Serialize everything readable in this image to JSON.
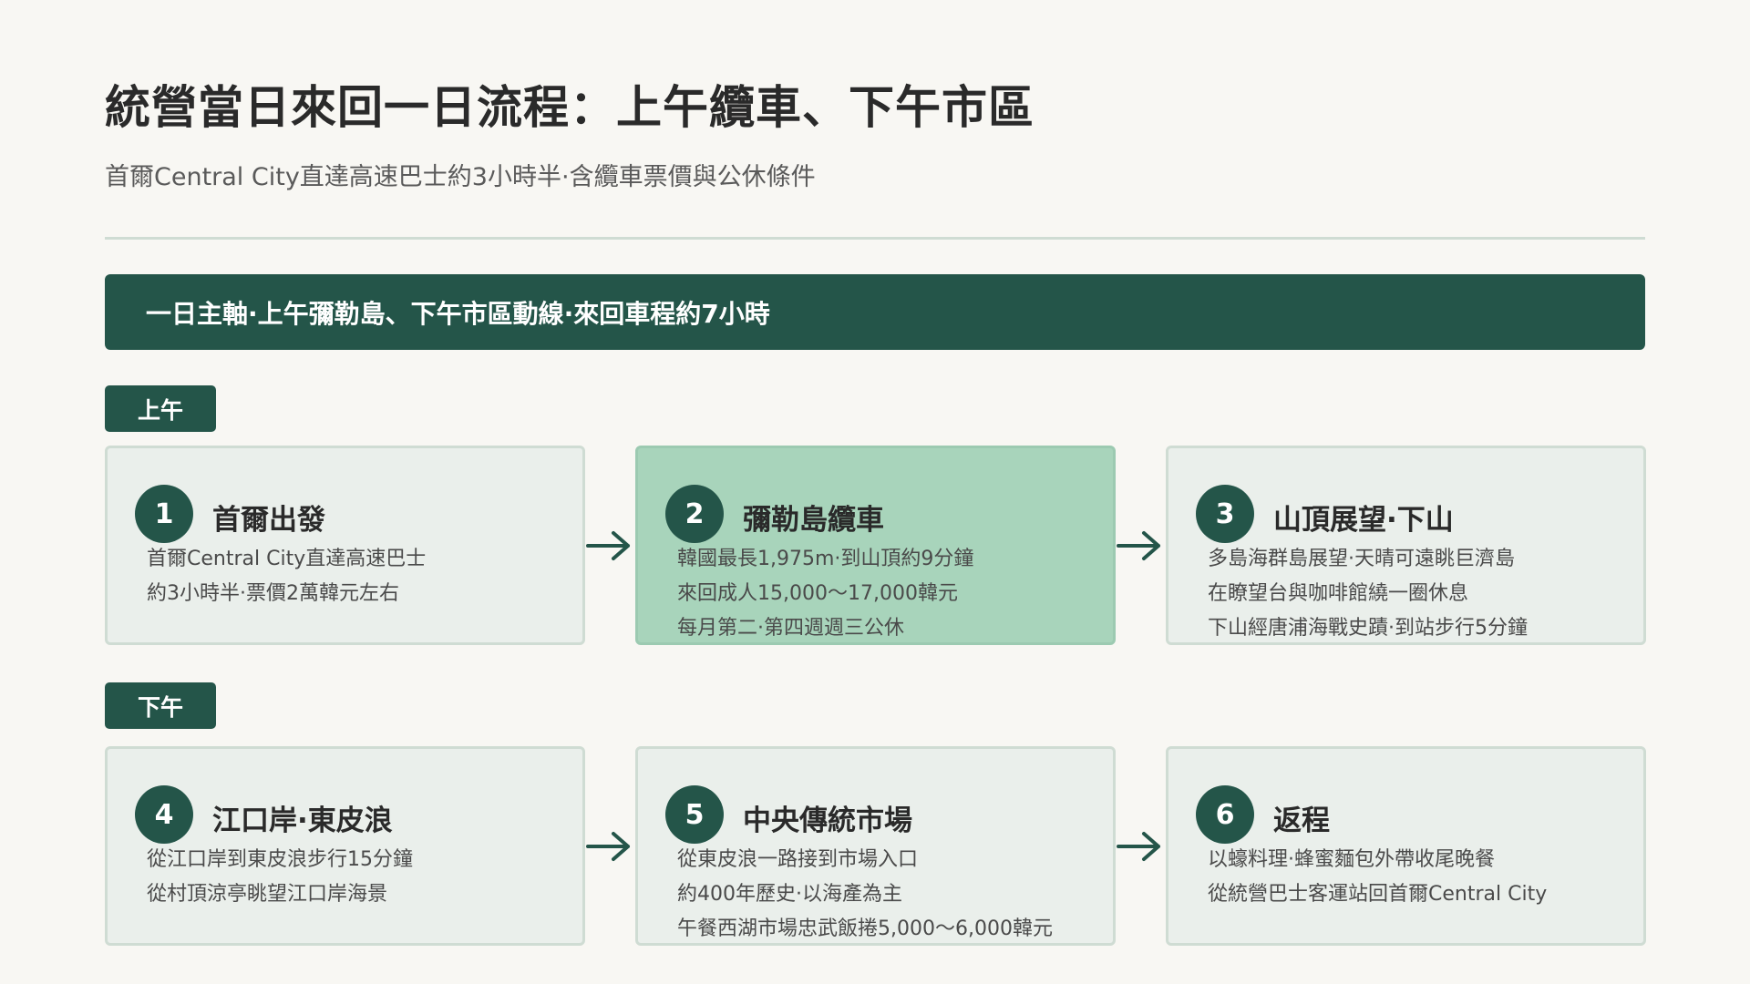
{
  "header": {
    "title": "統營當日來回一日流程：上午纜車、下午市區",
    "subtitle": "首爾Central City直達高速巴士約3小時半·含纜車票價與公休條件"
  },
  "banner": {
    "text": "一日主軸·上午彌勒島、下午市區動線·來回車程約7小時"
  },
  "sections": {
    "morning": "上午",
    "afternoon": "下午"
  },
  "steps": [
    {
      "num": "1",
      "title": "首爾出發",
      "lines": [
        "首爾Central City直達高速巴士",
        "約3小時半·票價2萬韓元左右"
      ]
    },
    {
      "num": "2",
      "title": "彌勒島纜車",
      "lines": [
        "韓國最長1,975m·到山頂約9分鐘",
        "來回成人15,000～17,000韓元",
        "每月第二·第四週週三公休"
      ]
    },
    {
      "num": "3",
      "title": "山頂展望·下山",
      "lines": [
        "多島海群島展望·天晴可遠眺巨濟島",
        "在瞭望台與咖啡館繞一圈休息",
        "下山經唐浦海戰史蹟·到站步行5分鐘"
      ]
    },
    {
      "num": "4",
      "title": "江口岸·東皮浪",
      "lines": [
        "從江口岸到東皮浪步行15分鐘",
        "從村頂涼亭眺望江口岸海景"
      ]
    },
    {
      "num": "5",
      "title": "中央傳統市場",
      "lines": [
        "從東皮浪一路接到市場入口",
        "約400年歷史·以海產為主",
        "午餐西湖市場忠武飯捲5,000～6,000韓元"
      ]
    },
    {
      "num": "6",
      "title": "返程",
      "lines": [
        "以蠔料理·蜂蜜麵包外帶收尾晚餐",
        "從統營巴士客運站回首爾Central City"
      ]
    }
  ],
  "colors": {
    "accent": "#245549",
    "card_bg": "#eaefeb",
    "card_highlight": "#a8d4bb",
    "page_bg": "#f8f7f3"
  },
  "icons": {
    "arrow": "arrow-right-icon"
  }
}
